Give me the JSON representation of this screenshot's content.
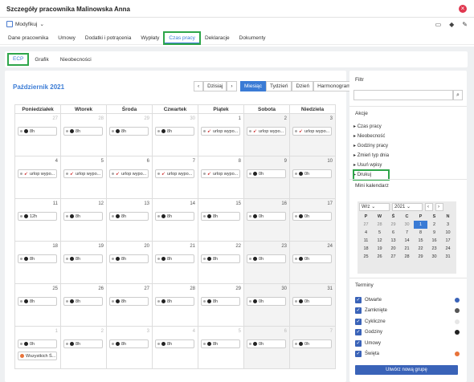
{
  "window": {
    "title": "Szczegóły pracownika Malinowska Anna"
  },
  "toolbar": {
    "modify_label": "Modyfikuj"
  },
  "tabs": [
    "Dane pracownika",
    "Umowy",
    "Dodatki i potrącenia",
    "Wypłaty",
    "Czas pracy",
    "Deklaracje",
    "Dokumenty"
  ],
  "active_tab": "Czas pracy",
  "subtabs": [
    "ECP",
    "Grafik",
    "Nieobecności"
  ],
  "calendar": {
    "month_label": "Październik 2021",
    "today_label": "Dzisiaj",
    "views": [
      "Miesiąc",
      "Tydzień",
      "Dzień",
      "Harmonogram"
    ],
    "active_view": "Miesiąc",
    "days_of_week": [
      "Poniedziałek",
      "Wtorek",
      "Środa",
      "Czwartek",
      "Piątek",
      "Sobota",
      "Niedziela"
    ],
    "cells": [
      {
        "day": "27",
        "other": true,
        "ev": "8h"
      },
      {
        "day": "28",
        "other": true,
        "ev": "8h"
      },
      {
        "day": "29",
        "other": true,
        "ev": "8h"
      },
      {
        "day": "30",
        "other": true,
        "ev": "8h"
      },
      {
        "day": "1",
        "ev": "urlop wypo...",
        "leave": true
      },
      {
        "day": "2",
        "ev": "urlop wypo...",
        "leave": true
      },
      {
        "day": "3",
        "ev": "urlop wypo...",
        "leave": true
      },
      {
        "day": "4",
        "ev": "urlop wypo...",
        "leave": true
      },
      {
        "day": "5",
        "ev": "urlop wypo...",
        "leave": true
      },
      {
        "day": "6",
        "ev": "urlop wypo...",
        "leave": true
      },
      {
        "day": "7",
        "ev": "urlop wypo...",
        "leave": true
      },
      {
        "day": "8",
        "ev": "urlop wypo...",
        "leave": true
      },
      {
        "day": "9",
        "ev": "0h"
      },
      {
        "day": "10",
        "ev": "0h"
      },
      {
        "day": "11",
        "ev": "12h"
      },
      {
        "day": "12",
        "ev": "8h"
      },
      {
        "day": "13",
        "ev": "8h"
      },
      {
        "day": "14",
        "ev": "8h"
      },
      {
        "day": "15",
        "ev": "8h"
      },
      {
        "day": "16",
        "ev": "0h"
      },
      {
        "day": "17",
        "ev": "0h"
      },
      {
        "day": "18",
        "ev": "8h"
      },
      {
        "day": "19",
        "ev": "8h"
      },
      {
        "day": "20",
        "ev": "8h"
      },
      {
        "day": "21",
        "ev": "8h"
      },
      {
        "day": "22",
        "ev": "8h"
      },
      {
        "day": "23",
        "ev": "0h"
      },
      {
        "day": "24",
        "ev": "0h"
      },
      {
        "day": "25",
        "ev": "8h"
      },
      {
        "day": "26",
        "ev": "8h"
      },
      {
        "day": "27",
        "ev": "8h"
      },
      {
        "day": "28",
        "ev": "8h"
      },
      {
        "day": "29",
        "ev": "8h"
      },
      {
        "day": "30",
        "ev": "0h"
      },
      {
        "day": "31",
        "ev": "0h"
      },
      {
        "day": "1",
        "other": true,
        "ev": "0h",
        "ev2": "Wszystkich Ś..."
      },
      {
        "day": "2",
        "other": true,
        "ev": "8h"
      },
      {
        "day": "3",
        "other": true,
        "ev": "8h"
      },
      {
        "day": "4",
        "other": true,
        "ev": "8h"
      },
      {
        "day": "5",
        "other": true,
        "ev": "8h"
      },
      {
        "day": "6",
        "other": true,
        "ev": "0h"
      },
      {
        "day": "7",
        "other": true,
        "ev": "0h"
      }
    ]
  },
  "sidebar": {
    "filter_label": "Filtr",
    "actions_label": "Akcje",
    "actions": [
      "Czas pracy",
      "Nieobecność",
      "Godziny pracy",
      "Zmień typ dnia",
      "Usuń wpisy",
      "Drukuj"
    ],
    "mini_label": "Mini kalendarz",
    "mini_month": "Wrz",
    "mini_year": "2021",
    "mini_dow": [
      "P",
      "W",
      "Ś",
      "C",
      "P",
      "S",
      "N"
    ],
    "mini_days": [
      [
        "27",
        "28",
        "29",
        "30",
        "1",
        "2",
        "3"
      ],
      [
        "4",
        "5",
        "6",
        "7",
        "8",
        "9",
        "10"
      ],
      [
        "11",
        "12",
        "13",
        "14",
        "15",
        "16",
        "17"
      ],
      [
        "18",
        "19",
        "20",
        "21",
        "22",
        "23",
        "24"
      ],
      [
        "25",
        "26",
        "27",
        "28",
        "29",
        "30",
        "31"
      ]
    ],
    "terms_label": "Terminy",
    "terms": [
      {
        "label": "Otwarte",
        "color": "#3a63b8"
      },
      {
        "label": "Zamknięte",
        "color": "#555555"
      },
      {
        "label": "Cykliczne",
        "color": "#e6e6e6"
      },
      {
        "label": "Godziny",
        "color": "#222222"
      },
      {
        "label": "Umowy",
        "color": ""
      },
      {
        "label": "Święta",
        "color": "#e8733a"
      }
    ],
    "new_group_label": "Utwórz nową grupę"
  }
}
